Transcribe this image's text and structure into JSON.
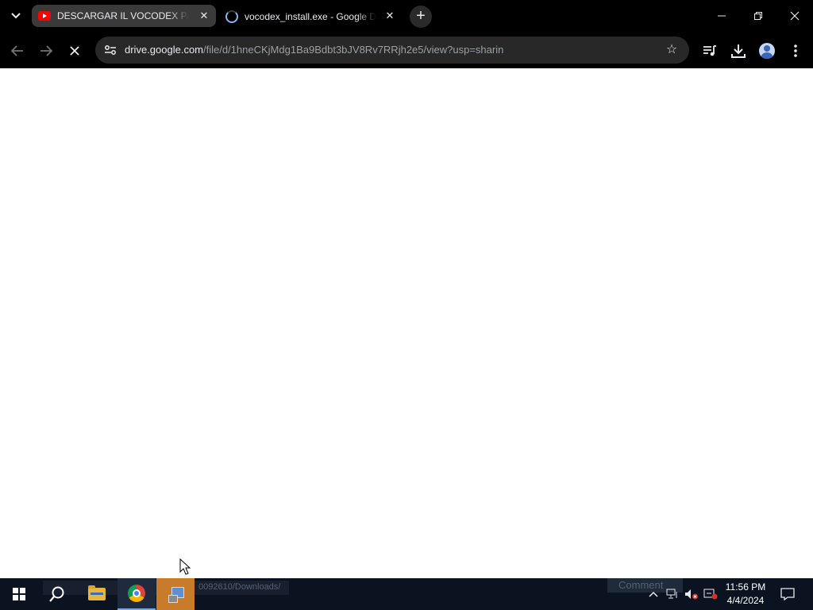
{
  "browser": {
    "tabs": [
      {
        "title": "DESCARGAR IL VOCODEX PARA",
        "icon": "youtube-icon",
        "active": true
      },
      {
        "title": "vocodex_install.exe - Google Dr",
        "icon": "loading-spinner-icon",
        "active": false
      }
    ],
    "new_tab_label": "+",
    "window_controls": {
      "minimize": "–",
      "restore": "❐",
      "close": "✕"
    },
    "address": {
      "host": "drive.google.com",
      "path": "/file/d/1hneCKjMdg1Ba9Bdbt3bJV8Rv7RRjh2e5/view?usp=sharin"
    }
  },
  "taskbar": {
    "ghost_text": "0092610/Downloads/",
    "ghost_button": "Comment",
    "clock": {
      "time": "11:56 PM",
      "date": "4/4/2024"
    }
  },
  "colors": {
    "chrome_bg": "#000000",
    "omnibox_bg": "#282828",
    "active_tab_bg": "#3a3a3a",
    "taskbar_bg": "#0b1320",
    "taskbar_highlight": "#c87b2a"
  }
}
